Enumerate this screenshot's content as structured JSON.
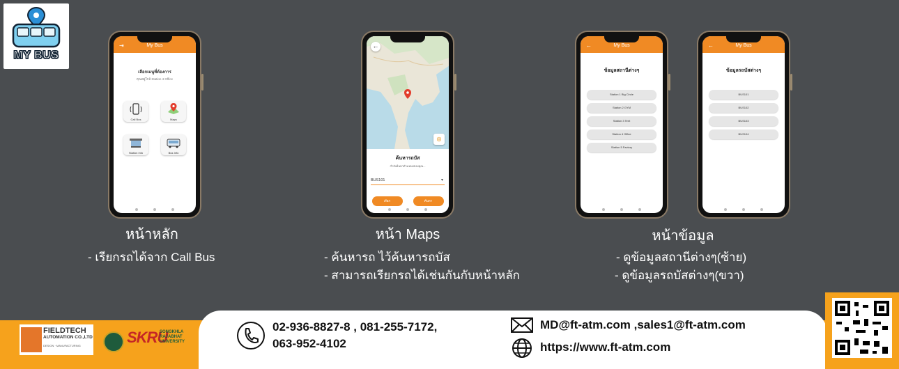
{
  "brand": {
    "logo_text": "MY BUS"
  },
  "home_phone": {
    "app_title": "My Bus",
    "heading": "เลือกเมนูที่ต้องการ",
    "subheading": "คุณอยู่ใกล้ Station 4 Office",
    "tiles": [
      "Call Bus",
      "Maps",
      "Station Info",
      "Bus Info"
    ]
  },
  "map_phone": {
    "panel_title": "ค้นหารถบัส",
    "panel_sub": "กำลังค้นหาตำแหน่งของคุณ...",
    "selected_bus": "BUS101",
    "btn_left": "เรียก",
    "btn_right": "ค้นหา"
  },
  "station_phone": {
    "app_title": "My Bus",
    "heading": "ข้อมูลสถานีต่างๆ",
    "items": [
      "Station 1 Big Circle",
      "Station 2 GYM",
      "Station 3 Tent",
      "Station 4 Office",
      "Station 5 Factory"
    ]
  },
  "bus_phone": {
    "app_title": "My Bus",
    "heading": "ข้อมูลรถบัสต่างๆ",
    "items": [
      "BUS101",
      "BUS102",
      "BUS103",
      "BUS104"
    ]
  },
  "captions": {
    "home": "หน้าหลัก",
    "maps": "หน้า Maps",
    "info": "หน้าข้อมูล"
  },
  "descriptions": {
    "home": [
      "- เรียกรถได้จาก Call Bus"
    ],
    "maps": [
      "- ค้นหารถ ไว้ค้นหารถบัส",
      "- สามารถเรียกรถได้เช่นกันกับหน้าหลัก"
    ],
    "info": [
      "- ดูข้อมูลสถานีต่างๆ(ซ้าย)",
      "- ดูข้อมูลรถบัสต่างๆ(ขวา)"
    ]
  },
  "footer": {
    "fieldtech_name": "FIELDTECH",
    "fieldtech_sub": "AUTOMATION CO.,LTD",
    "fieldtech_tiny": "DESIGN · MANUFACTURING",
    "skru_name": "SKRU",
    "skru_sub_1": "SONGKHLA",
    "skru_sub_2": "RAJABHAT",
    "skru_sub_3": "UNIVERSITY",
    "phone_line_1": "02-936-8827-8 , 081-255-7172,",
    "phone_line_2": "063-952-4102",
    "email": "MD@ft-atm.com ,sales1@ft-atm.com",
    "website": "https://www.ft-atm.com"
  },
  "colors": {
    "accent": "#f08a24",
    "footer": "#f6a21c",
    "background": "#4a4d50"
  }
}
